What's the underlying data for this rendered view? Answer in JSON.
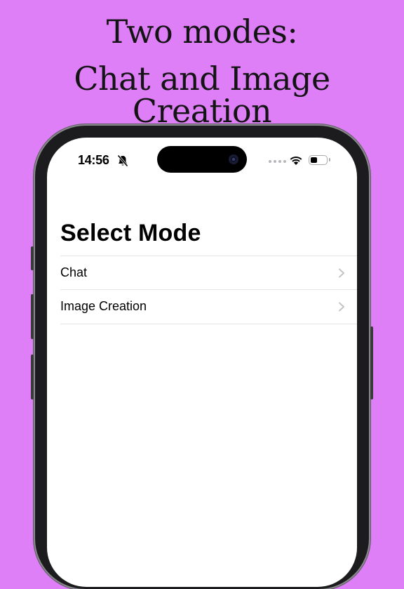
{
  "headline": {
    "line1": "Two modes:",
    "line2": "Chat and Image Creation"
  },
  "status_bar": {
    "time": "14:56",
    "silent_icon": "bell-slash-icon",
    "signal_icon": "signal-dots-icon",
    "wifi_icon": "wifi-icon",
    "battery_icon": "battery-icon",
    "battery_level": 0.45
  },
  "screen": {
    "title": "Select Mode",
    "modes": [
      {
        "label": "Chat",
        "icon": "chevron-right-icon"
      },
      {
        "label": "Image Creation",
        "icon": "chevron-right-icon"
      }
    ]
  },
  "colors": {
    "background": "#de7ff8",
    "headline": "#141414",
    "phone_frame": "#1c1c1e",
    "separator": "#e3e3e6",
    "chevron": "#c4c4c7"
  }
}
